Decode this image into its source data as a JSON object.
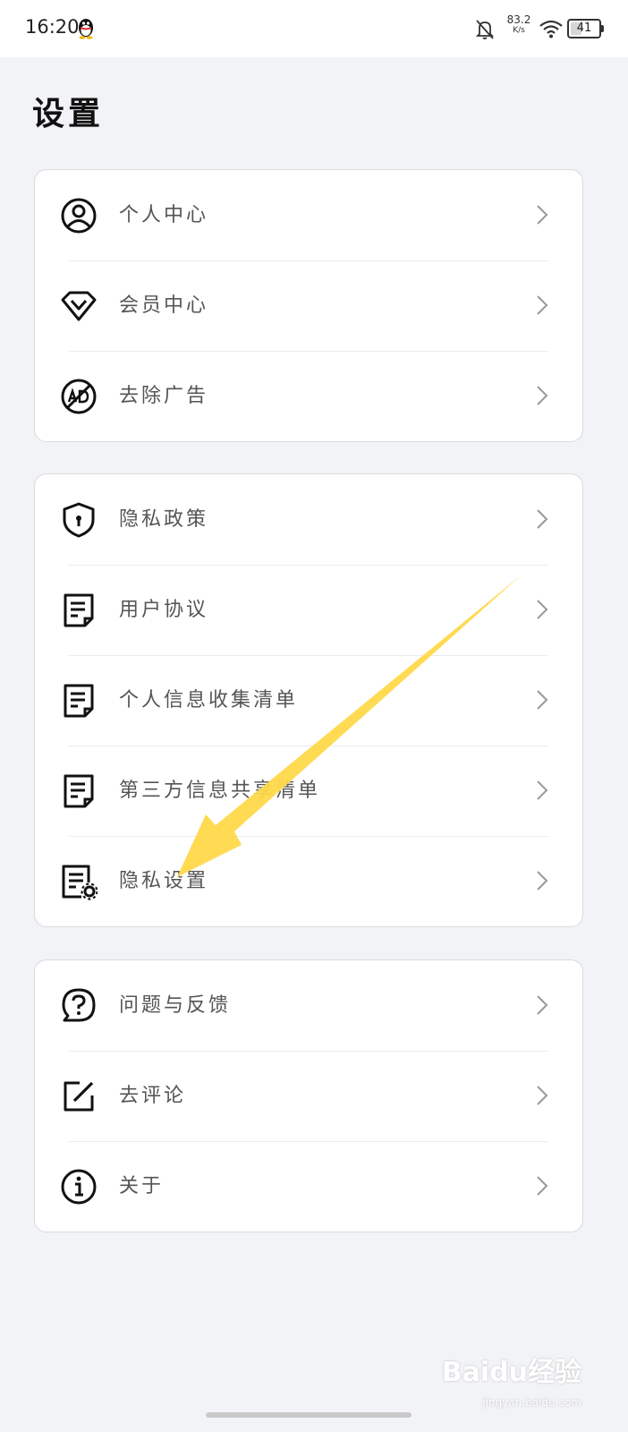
{
  "status_bar": {
    "time": "16:20",
    "net_speed_value": "83.2",
    "net_speed_unit": "K/s",
    "battery": "41",
    "battery_level_percent": 41,
    "icons": [
      "qq-icon",
      "bell-muted-icon",
      "wifi-icon",
      "battery-icon"
    ]
  },
  "page": {
    "title": "设置"
  },
  "groups": [
    {
      "items": [
        {
          "label": "个人中心",
          "icon": "user-circle-icon"
        },
        {
          "label": "会员中心",
          "icon": "diamond-icon"
        },
        {
          "label": "去除广告",
          "icon": "no-ad-icon"
        }
      ]
    },
    {
      "items": [
        {
          "label": "隐私政策",
          "icon": "shield-icon"
        },
        {
          "label": "用户协议",
          "icon": "document-icon"
        },
        {
          "label": "个人信息收集清单",
          "icon": "document-icon"
        },
        {
          "label": "第三方信息共享清单",
          "icon": "document-icon"
        },
        {
          "label": "隐私设置",
          "icon": "document-gear-icon"
        }
      ]
    },
    {
      "items": [
        {
          "label": "问题与反馈",
          "icon": "question-bubble-icon"
        },
        {
          "label": "去评论",
          "icon": "edit-icon"
        },
        {
          "label": "关于",
          "icon": "info-icon"
        }
      ]
    }
  ],
  "watermark": {
    "text": "Baidu经验",
    "sub": "jingyan.baidu.com"
  },
  "colors": {
    "background": "#f2f3f6",
    "card": "#ffffff",
    "annotation_arrow": "#ffd84a"
  }
}
